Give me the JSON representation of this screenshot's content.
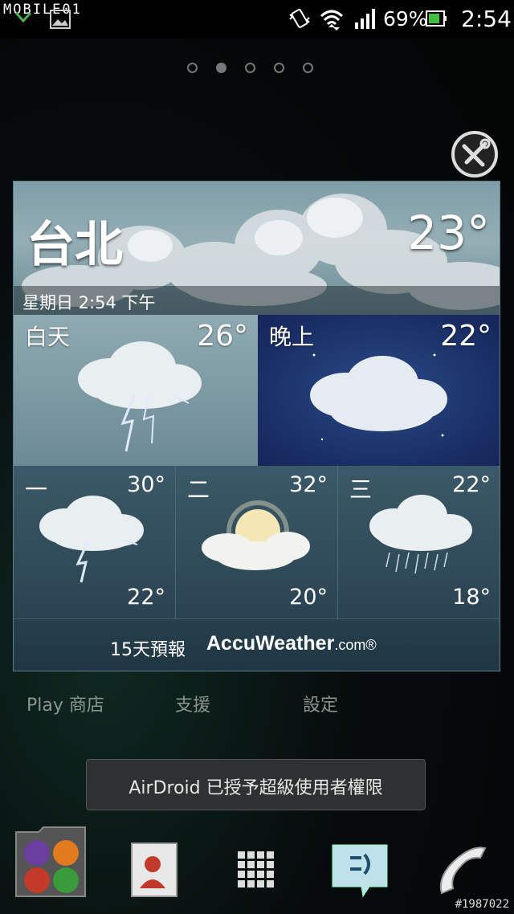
{
  "status_bar": {
    "watermark": "MOBILE01",
    "battery_percent": "69%",
    "clock": "2:54"
  },
  "home": {
    "page_count": 5,
    "active_page": 2,
    "app_labels": [
      "Play 商店",
      "支援",
      "設定"
    ]
  },
  "weather": {
    "city": "台北",
    "current_temp": "23°",
    "date_time": "星期日 2:54 下午",
    "day": {
      "label": "白天",
      "temp": "26°",
      "condition": "thunderstorm"
    },
    "night": {
      "label": "晚上",
      "temp": "22°",
      "condition": "cloudy"
    },
    "forecast": [
      {
        "day": "一",
        "high": "30°",
        "low": "22°",
        "condition": "thunderstorm"
      },
      {
        "day": "二",
        "high": "32°",
        "low": "20°",
        "condition": "partly-sunny"
      },
      {
        "day": "三",
        "high": "22°",
        "low": "18°",
        "condition": "rain"
      }
    ],
    "footer_forecast": "15天預報",
    "brand": "AccuWeather",
    "brand_suffix": ".com®"
  },
  "toast": {
    "text": "AirDroid 已授予超級使用者權限"
  },
  "dock": {
    "items": [
      "apps-folder-icon",
      "contacts-icon",
      "app-drawer-icon",
      "messaging-icon",
      "phone-icon"
    ]
  },
  "credit": "#1987022",
  "colors": {
    "night_bg": "#1a2f66",
    "widget_border": "#5a7b8c",
    "toast_bg": "#2e3131"
  }
}
